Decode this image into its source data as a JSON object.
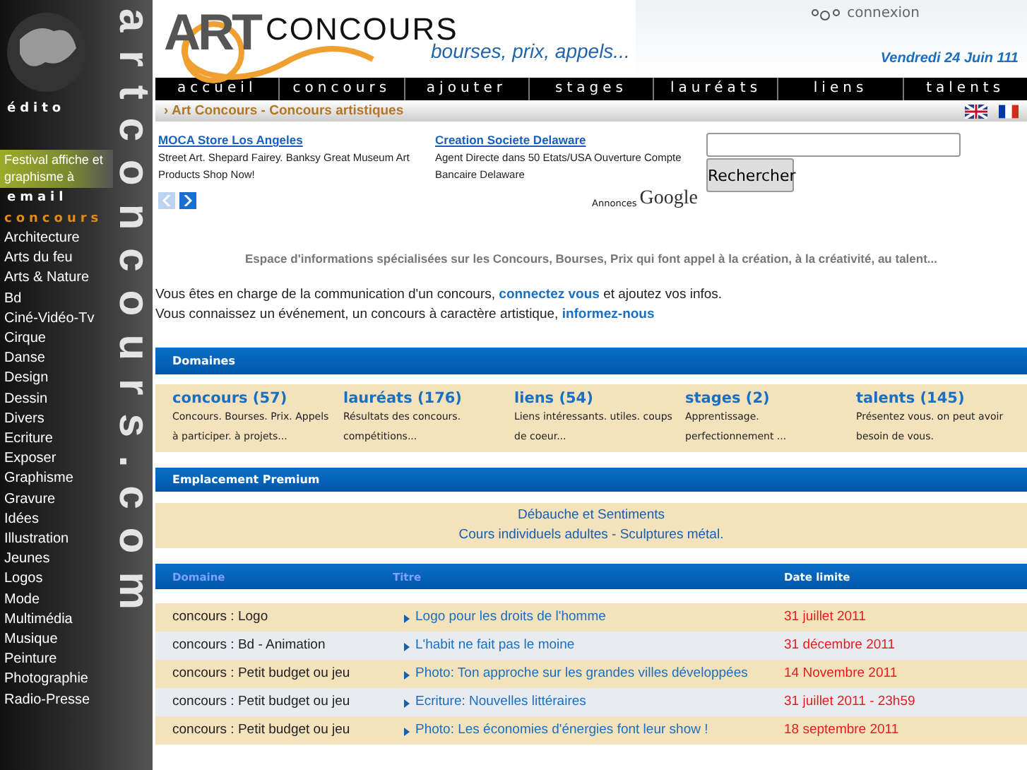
{
  "sidebar": {
    "edito": "édito",
    "festival": "Festival affiche et graphisme à",
    "email": "email",
    "section": "concours",
    "logo_text": "artconcours.com",
    "items": [
      "Architecture",
      "Arts du feu",
      "Arts & Nature",
      "Bd",
      "Ciné-Vidéo-Tv",
      "Cirque",
      "Danse",
      "Design",
      "Dessin",
      "Divers",
      "Ecriture",
      "Exposer",
      "Graphisme",
      "Gravure",
      "Idées",
      "Illustration",
      "Jeunes",
      "Logos",
      "Mode",
      "Multimédia",
      "Musique",
      "Peinture",
      "Photographie",
      "Radio-Presse"
    ]
  },
  "header": {
    "logo_art": "ART",
    "logo_concours": "CONCOURS",
    "slogan": "bourses, prix, appels...",
    "login": "connexion",
    "date": "Vendredi 24 Juin 111"
  },
  "nav": [
    "accueil",
    "concours",
    "ajouter",
    "stages",
    "lauréats",
    "liens",
    "talents"
  ],
  "breadcrumb_marker": "›",
  "breadcrumb": "Art Concours - Concours artistiques",
  "ads": [
    {
      "title": "MOCA Store Los Angeles",
      "text": "Street Art. Shepard Fairey. Banksy Great Museum Art Products Shop Now!"
    },
    {
      "title": "Creation Societe Delaware",
      "text": "Agent Directe dans 50 Etats/USA Ouverture Compte Bancaire Delaware"
    }
  ],
  "ads_label": "Annonces",
  "ads_brand": "Google",
  "search_button": "Rechercher",
  "tagline": "Espace d'informations spécialisées sur les Concours, Bourses, Prix qui font appel à la création, à la créativité, au talent...",
  "intro": [
    {
      "before": "Vous êtes en charge de la communication d'un concours, ",
      "link": "connectez vous",
      "after": " et ajoutez vos infos."
    },
    {
      "before": "Vous connaissez un événement, un concours à caractère artistique, ",
      "link": "informez-nous"
    }
  ],
  "domains": {
    "title": "Domaines",
    "items": [
      {
        "name": "concours (57)",
        "text": "Concours. Bourses. Prix. Appels à participer. à projets..."
      },
      {
        "name": "lauréats (176)",
        "text": "Résultats des concours. compétitions..."
      },
      {
        "name": "liens (54)",
        "text": "Liens intéressants. utiles. coups de coeur..."
      },
      {
        "name": "stages (2)",
        "text": "Apprentissage. perfectionnement ..."
      },
      {
        "name": "talents (145)",
        "text": "Présentez vous. on peut avoir besoin de vous."
      }
    ]
  },
  "premium": {
    "title": "Emplacement Premium",
    "lines": [
      "Débauche et Sentiments",
      "Cours individuels adultes - Sculptures métal."
    ]
  },
  "table": {
    "columns": [
      "Domaine",
      "Titre",
      "Date limite"
    ],
    "rows": [
      [
        "concours : Logo",
        "Logo pour les droits de l'homme",
        "31 juillet 2011"
      ],
      [
        "concours : Bd - Animation",
        "L'habit ne fait pas le moine",
        "31 décembre 2011"
      ],
      [
        "concours : Petit budget ou jeu",
        "Photo: Ton approche sur les grandes villes développées",
        "14 Novembre 2011"
      ],
      [
        "concours : Petit budget ou jeu",
        "Ecriture: Nouvelles littéraires",
        "31 juillet 2011 - 23h59"
      ],
      [
        "concours : Petit budget ou jeu",
        "Photo: Les économies d'énergies font leur show !",
        "18 septembre 2011"
      ]
    ]
  }
}
